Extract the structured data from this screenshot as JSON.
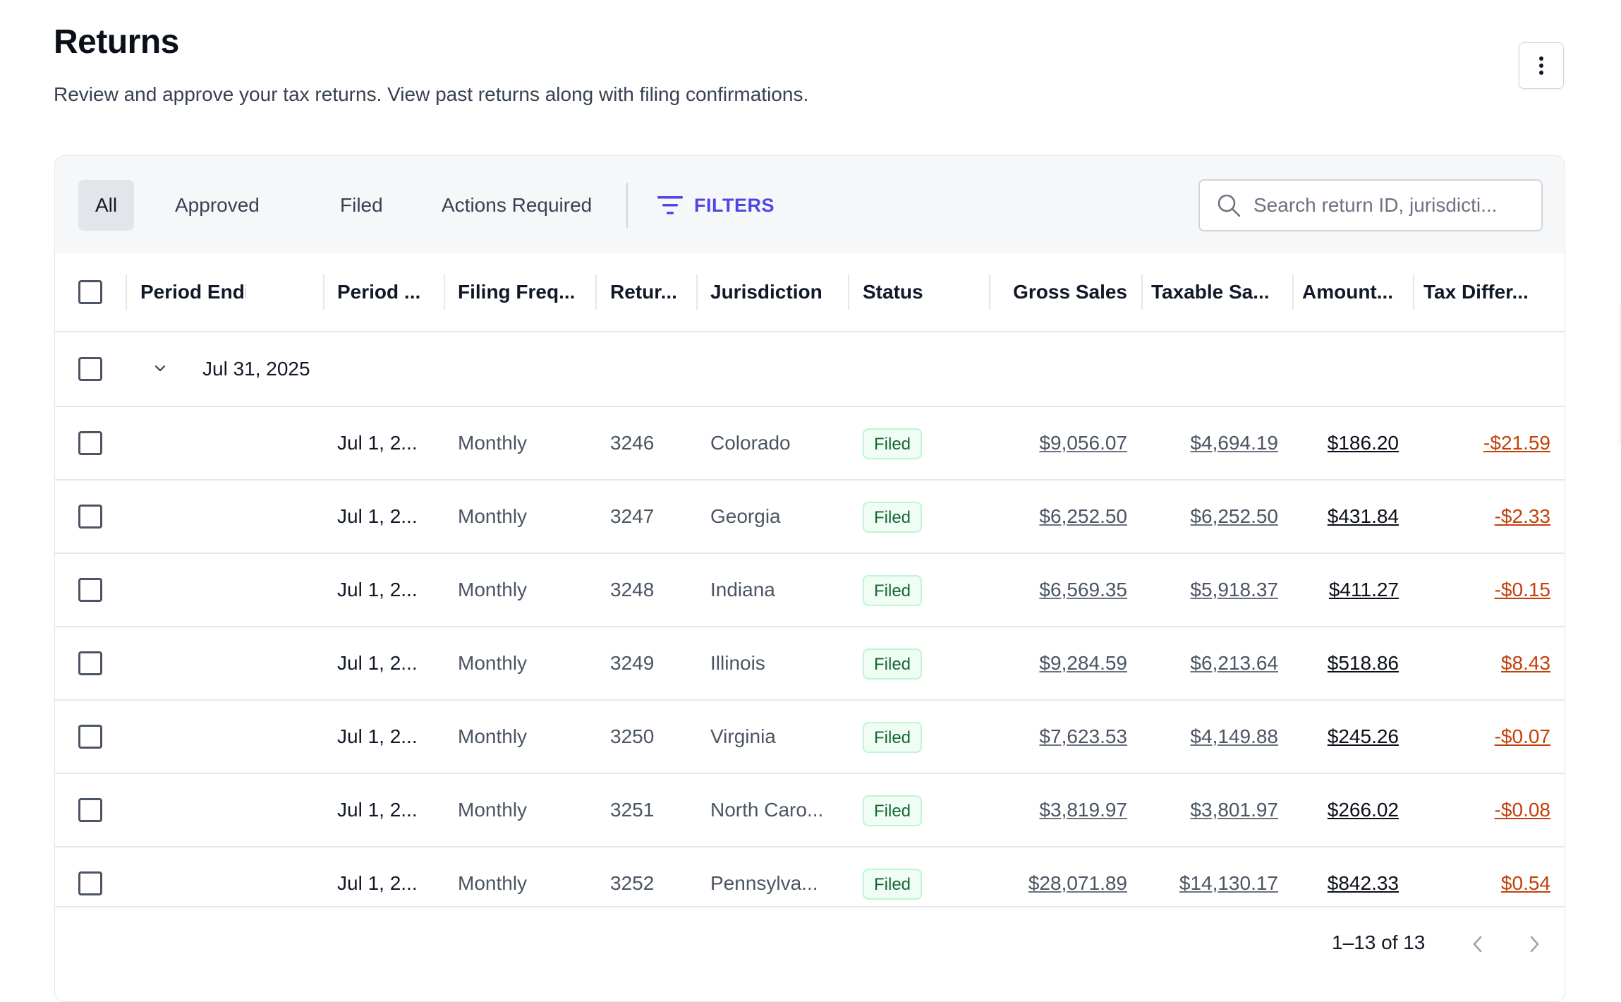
{
  "header": {
    "title": "Returns",
    "subtitle": "Review and approve your tax returns. View past returns along with filing confirmations.",
    "more_icon": "kebab-vertical-icon"
  },
  "toolbar": {
    "tabs": [
      {
        "label": "All",
        "active": true
      },
      {
        "label": "Approved",
        "active": false
      },
      {
        "label": "Filed",
        "active": false
      },
      {
        "label": "Actions Required",
        "active": false
      }
    ],
    "filters_label": "FILTERS",
    "filters_icon": "filter-lines-icon",
    "search_placeholder": "Search return ID, jurisdicti...",
    "search_value": "",
    "search_icon": "search-icon"
  },
  "table": {
    "columns": [
      "Period Ending",
      "Period ...",
      "Filing Freq...",
      "Retur...",
      "Jurisdiction",
      "Status",
      "Gross Sales",
      "Taxable Sa...",
      "Amount...",
      "Tax Differ..."
    ],
    "group": {
      "label": "Jul 31, 2025",
      "expanded": true
    },
    "rows": [
      {
        "period_start": "Jul 1, 2...",
        "frequency": "Monthly",
        "return_id": "3246",
        "jurisdiction": "Colorado",
        "status": "Filed",
        "gross_sales": "$9,056.07",
        "taxable_sales": "$4,694.19",
        "amount": "$186.20",
        "tax_difference": "-$21.59"
      },
      {
        "period_start": "Jul 1, 2...",
        "frequency": "Monthly",
        "return_id": "3247",
        "jurisdiction": "Georgia",
        "status": "Filed",
        "gross_sales": "$6,252.50",
        "taxable_sales": "$6,252.50",
        "amount": "$431.84",
        "tax_difference": "-$2.33"
      },
      {
        "period_start": "Jul 1, 2...",
        "frequency": "Monthly",
        "return_id": "3248",
        "jurisdiction": "Indiana",
        "status": "Filed",
        "gross_sales": "$6,569.35",
        "taxable_sales": "$5,918.37",
        "amount": "$411.27",
        "tax_difference": "-$0.15"
      },
      {
        "period_start": "Jul 1, 2...",
        "frequency": "Monthly",
        "return_id": "3249",
        "jurisdiction": "Illinois",
        "status": "Filed",
        "gross_sales": "$9,284.59",
        "taxable_sales": "$6,213.64",
        "amount": "$518.86",
        "tax_difference": "$8.43"
      },
      {
        "period_start": "Jul 1, 2...",
        "frequency": "Monthly",
        "return_id": "3250",
        "jurisdiction": "Virginia",
        "status": "Filed",
        "gross_sales": "$7,623.53",
        "taxable_sales": "$4,149.88",
        "amount": "$245.26",
        "tax_difference": "-$0.07"
      },
      {
        "period_start": "Jul 1, 2...",
        "frequency": "Monthly",
        "return_id": "3251",
        "jurisdiction": "North Caro...",
        "status": "Filed",
        "gross_sales": "$3,819.97",
        "taxable_sales": "$3,801.97",
        "amount": "$266.02",
        "tax_difference": "-$0.08"
      },
      {
        "period_start": "Jul 1, 2...",
        "frequency": "Monthly",
        "return_id": "3252",
        "jurisdiction": "Pennsylva...",
        "status": "Filed",
        "gross_sales": "$28,071.89",
        "taxable_sales": "$14,130.17",
        "amount": "$842.33",
        "tax_difference": "$0.54"
      }
    ]
  },
  "pagination": {
    "range_text": "1–13 of 13",
    "prev_icon": "chevron-left-icon",
    "next_icon": "chevron-right-icon"
  },
  "colors": {
    "accent": "#4f46e5",
    "status_filed_text": "#166534",
    "status_filed_bg": "#f0fdf4",
    "tax_difference": "#c2410c"
  }
}
